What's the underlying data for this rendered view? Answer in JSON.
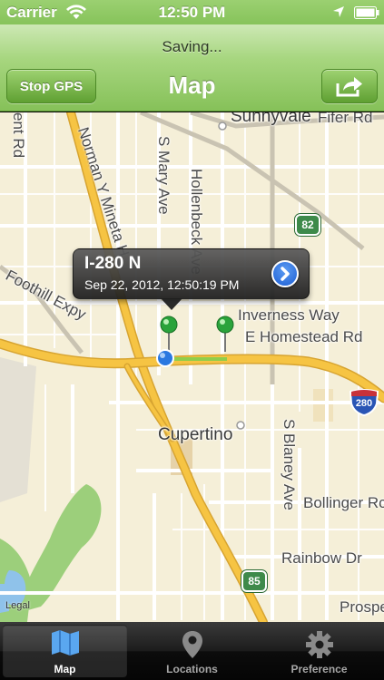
{
  "status_bar": {
    "carrier": "Carrier",
    "time": "12:50 PM",
    "icons": [
      "wifi-icon",
      "location-arrow-icon",
      "battery-icon"
    ]
  },
  "nav": {
    "status_text": "Saving...",
    "title": "Map",
    "left_button": "Stop GPS",
    "right_button_icon": "share-icon"
  },
  "map": {
    "labels": {
      "sunnyvale": "Sunnyvale",
      "fifer_rd": "Fifer Rd",
      "ent_rd": "ent Rd",
      "norman_y_mineta": "Norman Y Mineta H",
      "s_mary_ave": "S Mary Ave",
      "hollenbeck_ave": "Hollenbeck Ave",
      "foothill_expy": "Foothill Expy",
      "inverness_way": "Inverness Way",
      "e_homestead_rd": "E Homestead Rd",
      "cupertino": "Cupertino",
      "s_blaney_ave": "S Blaney Ave",
      "bollinger_rd": "Bollinger Rc",
      "rainbow_dr": "Rainbow Dr",
      "prospect": "Prospe",
      "legal": "Legal"
    },
    "shields": {
      "ca82": "82",
      "i280": "280",
      "ca85": "85"
    },
    "callout": {
      "title": "I-280 N",
      "subtitle": "Sep 22, 2012, 12:50:19 PM"
    },
    "colors": {
      "land": "#f5efd8",
      "highway": "#f6c443",
      "route": "#8fcd4c",
      "park": "#9ccf7b",
      "water": "#8fc2ea"
    }
  },
  "tabs": [
    {
      "label": "Map",
      "icon": "map-icon",
      "active": true
    },
    {
      "label": "Locations",
      "icon": "location-pin-icon",
      "active": false
    },
    {
      "label": "Preference",
      "icon": "gear-icon",
      "active": false
    }
  ]
}
